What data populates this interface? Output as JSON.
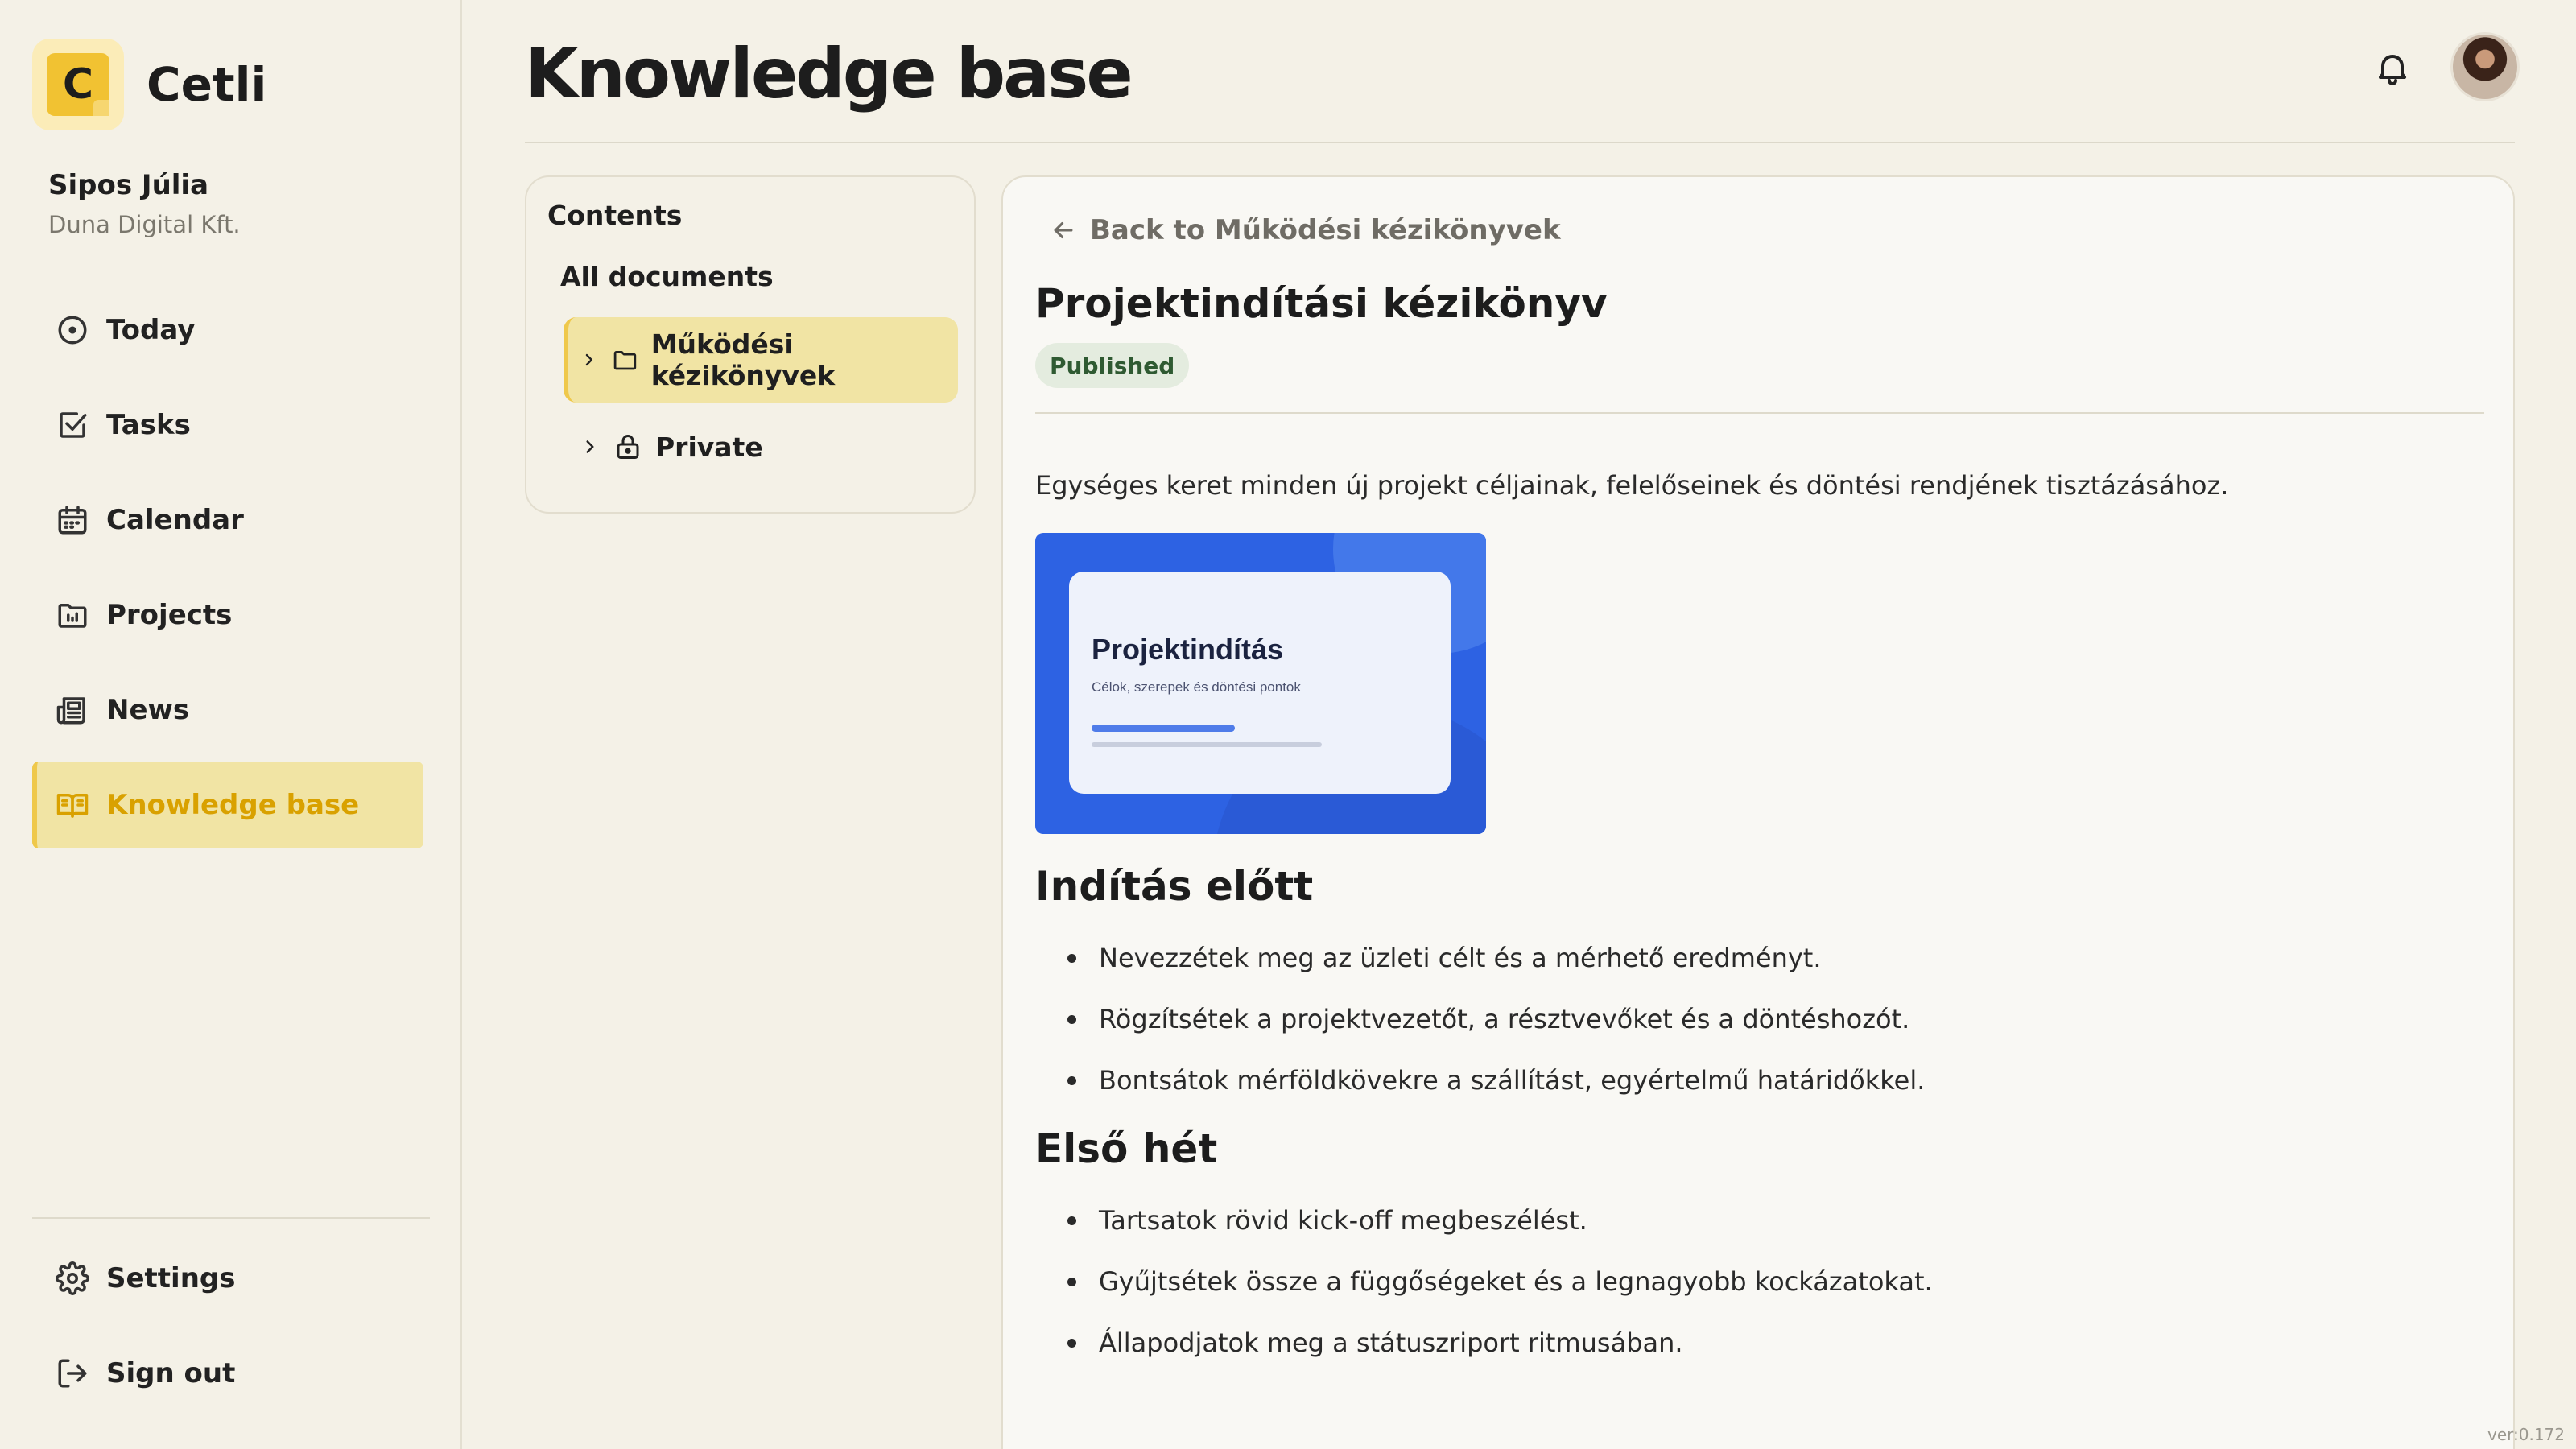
{
  "app": {
    "name": "Cetli",
    "logo_letter": "C",
    "accent": "#f1c232"
  },
  "user": {
    "name": "Sipos Júlia",
    "org": "Duna Digital Kft."
  },
  "nav": {
    "items": [
      {
        "label": "Today",
        "icon": "clock-icon"
      },
      {
        "label": "Tasks",
        "icon": "checkbox-icon"
      },
      {
        "label": "Calendar",
        "icon": "calendar-icon"
      },
      {
        "label": "Projects",
        "icon": "folder-chart-icon"
      },
      {
        "label": "News",
        "icon": "newspaper-icon"
      },
      {
        "label": "Knowledge base",
        "icon": "book-open-icon",
        "active": true
      }
    ],
    "bottom": [
      {
        "label": "Settings",
        "icon": "gear-icon"
      },
      {
        "label": "Sign out",
        "icon": "sign-out-icon"
      }
    ]
  },
  "header": {
    "title": "Knowledge base"
  },
  "contents": {
    "title": "Contents",
    "all_documents": "All documents",
    "tree": [
      {
        "label": "Működési kézikönyvek",
        "icon": "folder-icon",
        "active": true
      },
      {
        "label": "Private",
        "icon": "lock-icon"
      }
    ]
  },
  "article": {
    "back_label": "Back to Működési kézikönyvek",
    "title": "Projektindítási kézikönyv",
    "status": "Published",
    "intro": "Egységes keret minden új projekt céljainak, felelőseinek és döntési rendjének tisztázásához.",
    "cover": {
      "title": "Projektindítás",
      "subtitle": "Célok, szerepek és döntési pontok"
    },
    "sections": [
      {
        "heading": "Indítás előtt",
        "items": [
          "Nevezzétek meg az üzleti célt és a mérhető eredményt.",
          "Rögzítsétek a projektvezetőt, a résztvevőket és a döntéshozót.",
          "Bontsátok mérföldkövekre a szállítást, egyértelmű határidőkkel."
        ]
      },
      {
        "heading": "Első hét",
        "items": [
          "Tartsatok rövid kick-off megbeszélést.",
          "Gyűjtsétek össze a függőségeket és a legnagyobb kockázatokat.",
          "Állapodjatok meg a státuszriport ritmusában."
        ]
      }
    ]
  },
  "version": "ver:0.172"
}
